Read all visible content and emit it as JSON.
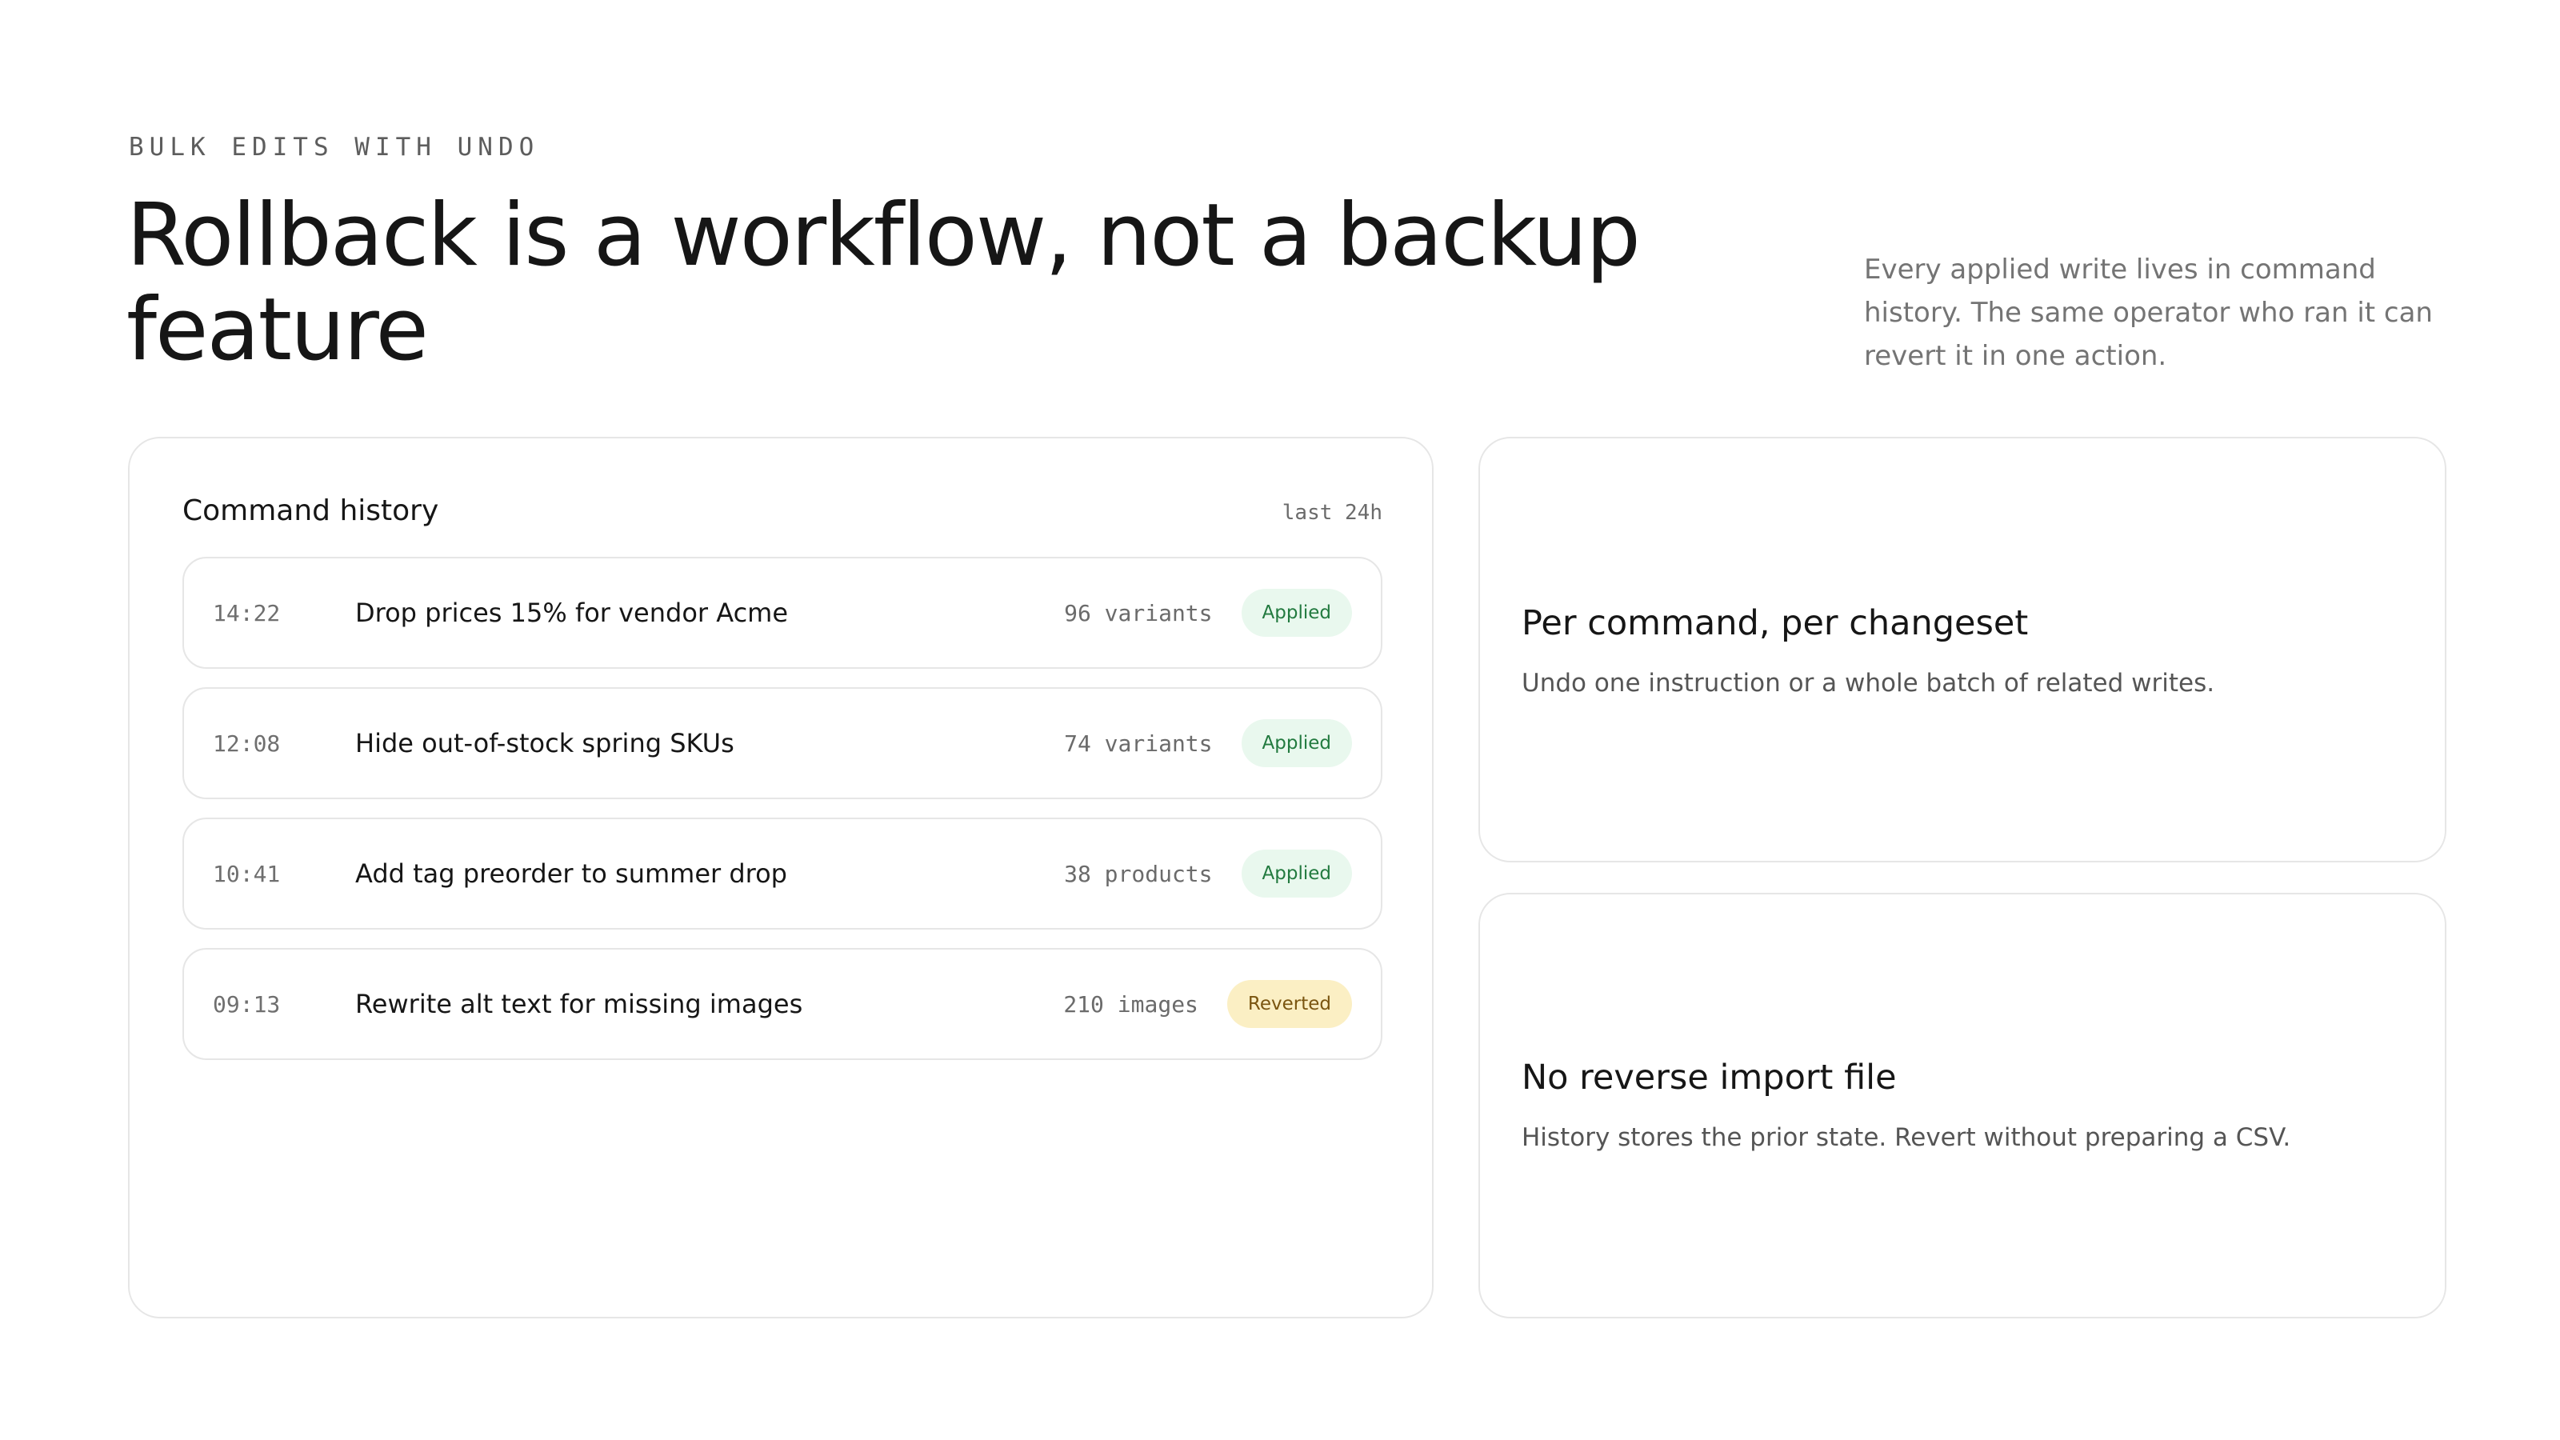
{
  "header": {
    "eyebrow": "BULK EDITS WITH UNDO",
    "headline": "Rollback is a workflow, not a backup feature",
    "lede": "Every applied write lives in command history. The same operator who ran it can revert it in one action."
  },
  "history": {
    "title": "Command history",
    "range": "last 24h",
    "rows": [
      {
        "time": "14:22",
        "description": "Drop prices 15% for vendor Acme",
        "count": "96 variants",
        "status": "Applied"
      },
      {
        "time": "12:08",
        "description": "Hide out-of-stock spring SKUs",
        "count": "74 variants",
        "status": "Applied"
      },
      {
        "time": "10:41",
        "description": "Add tag preorder to summer drop",
        "count": "38 products",
        "status": "Applied"
      },
      {
        "time": "09:13",
        "description": "Rewrite alt text for missing images",
        "count": "210 images",
        "status": "Reverted"
      }
    ]
  },
  "features": [
    {
      "title": "Per command, per changeset",
      "description": "Undo one instruction or a whole batch of related writes."
    },
    {
      "title": "No reverse import file",
      "description": "History stores the prior state. Revert without preparing a CSV."
    }
  ],
  "colors": {
    "applied_bg": "#e9f8ee",
    "applied_text": "#227a3f",
    "reverted_bg": "#fbefc4",
    "reverted_text": "#7a5510"
  }
}
